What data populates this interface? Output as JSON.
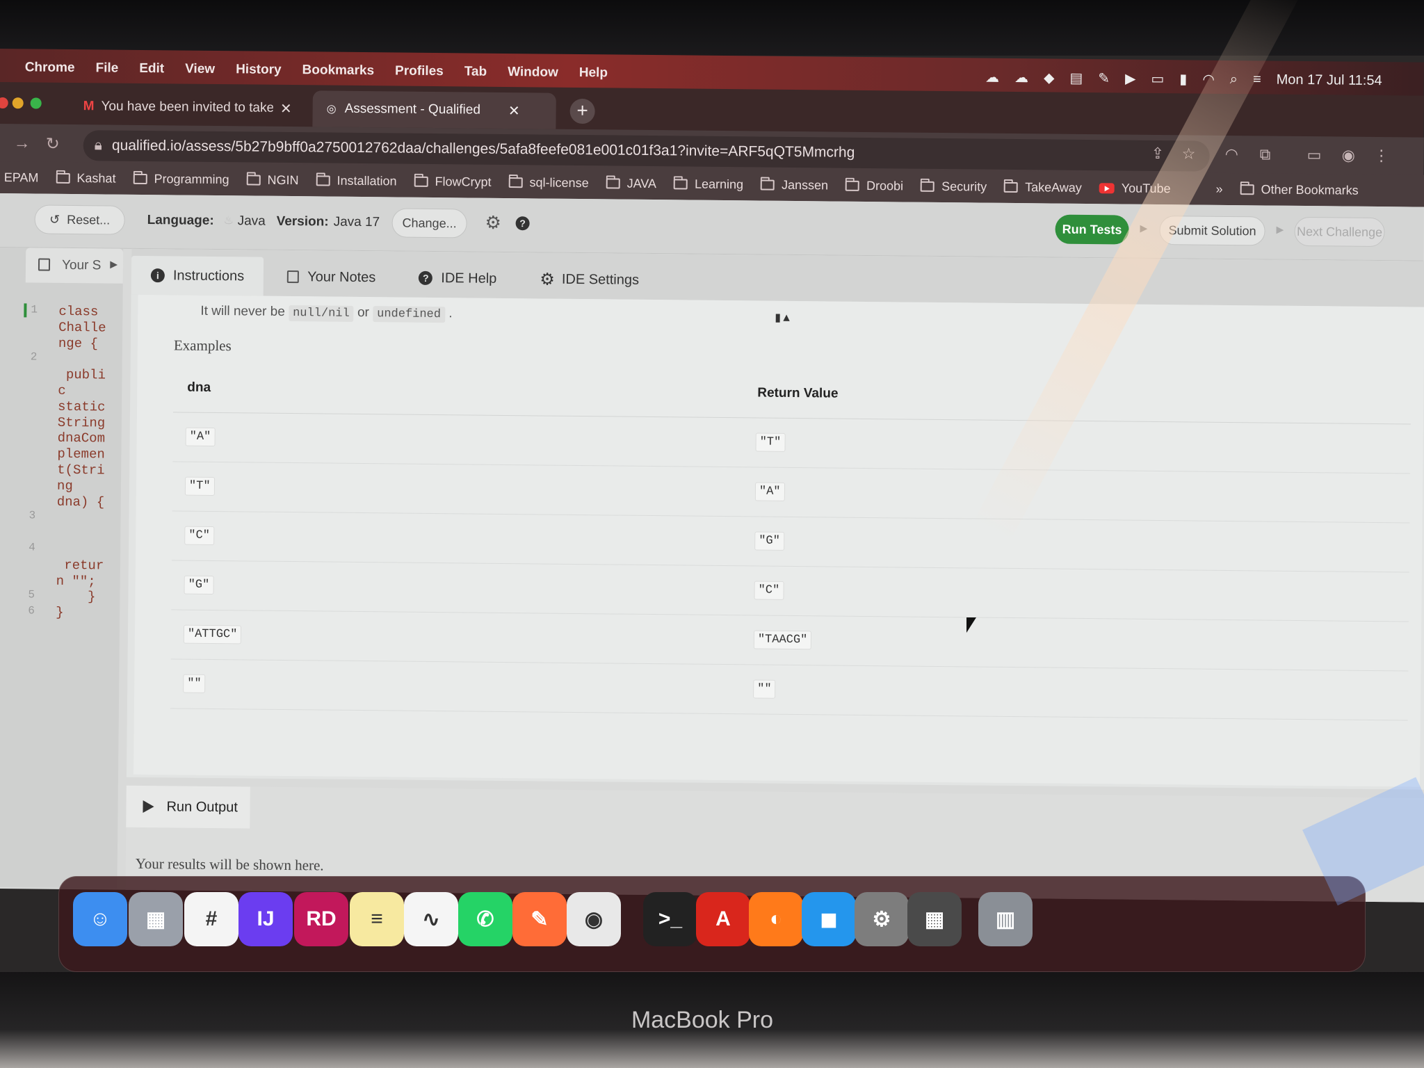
{
  "menubar": {
    "apple": "",
    "items": [
      "Chrome",
      "File",
      "Edit",
      "View",
      "History",
      "Bookmarks",
      "Profiles",
      "Tab",
      "Window",
      "Help"
    ],
    "clock": "Mon 17 Jul 11:54"
  },
  "tabs": [
    {
      "title": "You have been invited to take",
      "icon": "gmail-icon"
    },
    {
      "title": "Assessment - Qualified",
      "icon": "qualified-icon"
    }
  ],
  "address": {
    "url": "qualified.io/assess/5b27b9bff0a2750012762daa/challenges/5afa8feefe081e001c01f3a1?invite=ARF5qQT5Mmcrhg"
  },
  "bookmarks": [
    "EPAM",
    "Kashat",
    "Programming",
    "NGIN",
    "Installation",
    "FlowCrypt",
    "sql-license",
    "JAVA",
    "Learning",
    "Janssen",
    "Droobi",
    "Security",
    "TakeAway",
    "YouTube"
  ],
  "bookmarks_more": "»",
  "bookmarks_other": "Other Bookmarks",
  "toolbar": {
    "reset": "Reset...",
    "language_label": "Language:",
    "language": "Java",
    "version_label": "Version:",
    "version": "Java 17",
    "change": "Change...",
    "run_tests": "Run Tests",
    "submit": "Submit Solution",
    "next": "Next Challenge"
  },
  "editor": {
    "tab": "Your S",
    "lines": [
      {
        "n": "1",
        "text": "class"
      },
      {
        "n": "",
        "text": "Challe"
      },
      {
        "n": "",
        "text": "nge {"
      },
      {
        "n": "2",
        "text": ""
      },
      {
        "n": "",
        "text": " publi"
      },
      {
        "n": "",
        "text": "c"
      },
      {
        "n": "",
        "text": "static"
      },
      {
        "n": "",
        "text": "String"
      },
      {
        "n": "",
        "text": "dnaCom"
      },
      {
        "n": "",
        "text": "plemen"
      },
      {
        "n": "",
        "text": "t(Stri"
      },
      {
        "n": "",
        "text": "ng"
      },
      {
        "n": "",
        "text": "dna) {"
      },
      {
        "n": "3",
        "text": ""
      },
      {
        "n": "",
        "text": ""
      },
      {
        "n": "4",
        "text": ""
      },
      {
        "n": "",
        "text": " retur"
      },
      {
        "n": "",
        "text": "n \"\";"
      },
      {
        "n": "5",
        "text": "    }"
      },
      {
        "n": "6",
        "text": "}"
      }
    ]
  },
  "instructions": {
    "tabs": [
      "Instructions",
      "Your Notes",
      "IDE Help",
      "IDE Settings"
    ],
    "never_prefix": "It will never be",
    "never_code1": "null/nil",
    "never_or": "or",
    "never_code2": "undefined",
    "never_suffix": ".",
    "examples_heading": "Examples",
    "table_headers": [
      "dna",
      "Return Value"
    ],
    "rows": [
      [
        "\"A\"",
        "\"T\""
      ],
      [
        "\"T\"",
        "\"A\""
      ],
      [
        "\"C\"",
        "\"G\""
      ],
      [
        "\"G\"",
        "\"C\""
      ],
      [
        "\"ATTGC\"",
        "\"TAACG\""
      ],
      [
        "\"\"",
        "\"\""
      ]
    ]
  },
  "run_output": {
    "title": "Run Output",
    "message": "Your results will be shown here."
  },
  "dock": [
    "Finder",
    "Launchpad",
    "Slack",
    "IntelliJ IDEA",
    "Rider",
    "Notes",
    "Freeform",
    "WhatsApp",
    "Postman",
    "Chrome",
    "Terminal",
    "Acrobat",
    "Firefox",
    "Docker",
    "System Settings",
    "Calculator",
    "Trash"
  ],
  "laptop_label": "MacBook Pro"
}
